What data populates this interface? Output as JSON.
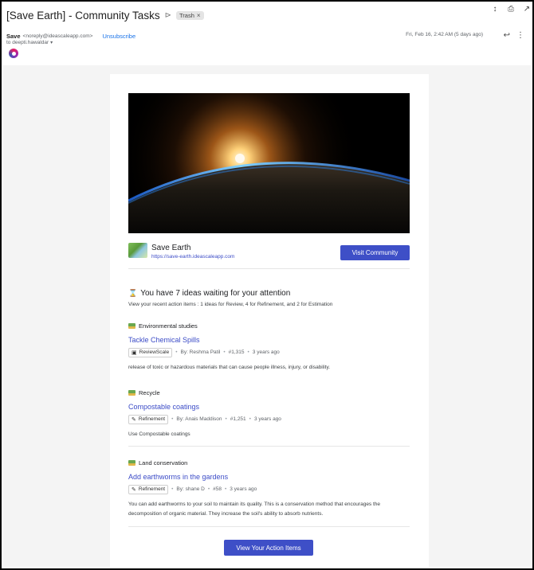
{
  "email": {
    "subject": "[Save Earth] - Community Tasks",
    "label": "Trash",
    "sender_name": "Save",
    "sender_email": "<noreply@ideascaleapp.com>",
    "unsubscribe": "Unsubscribe",
    "to": "to deepti.hawaldar",
    "date": "Fri, Feb 16, 2:42 AM (5 days ago)"
  },
  "brand": {
    "name": "Save Earth",
    "url": "https://save-earth.ideascaleapp.com",
    "visit_label": "Visit Community"
  },
  "waiting": {
    "title": "You have 7 ideas waiting for your attention",
    "subtitle": "View your recent action items : 1 ideas for Review, 4 for Refinement, and 2 for Estimation"
  },
  "ideas": [
    {
      "category": "Environmental studies",
      "title": "Tackle Chemical Spills",
      "stage": "ReviewScale",
      "author": "By: Reshma Patil",
      "number": "#1,315",
      "age": "3 years ago",
      "description": "release of toxic or hazardous materials that can cause people illness, injury, or disability."
    },
    {
      "category": "Recycle",
      "title": "Compostable coatings",
      "stage": "Refinement",
      "author": "By: Anais Maddison",
      "number": "#1,251",
      "age": "3 years ago",
      "description": "Use Compostable coatings"
    },
    {
      "category": "Land conservation",
      "title": "Add earthworms in the gardens",
      "stage": "Refinement",
      "author": "By: shane D",
      "number": "#58",
      "age": "3 years ago",
      "description": "You can add earthworms to your soil to maintain its quality. This is a conservation method that encourages the decomposition of organic material. They increase the soil's ability to absorb nutrients."
    }
  ],
  "footer": {
    "action_label": "View Your Action Items"
  },
  "colors": {
    "accent": "#3e4fc7",
    "link": "#3c4cc7"
  }
}
